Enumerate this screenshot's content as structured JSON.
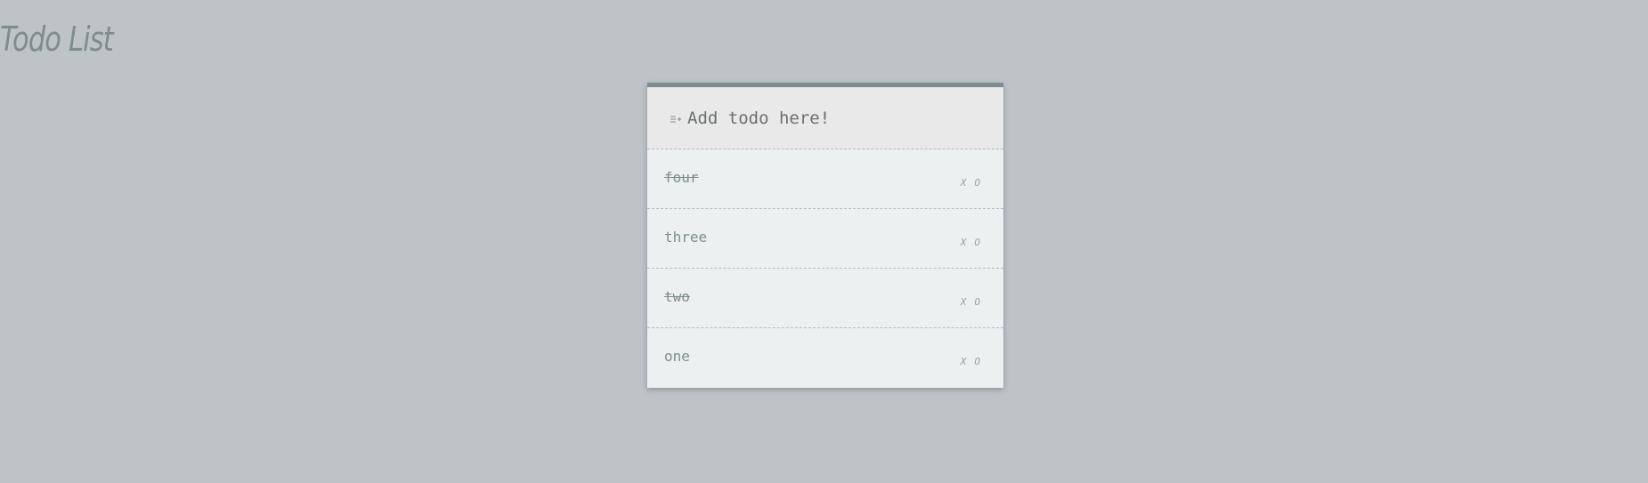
{
  "app": {
    "title": "Todo List"
  },
  "add_todo": {
    "placeholder": "Add todo here!",
    "icon": "add-list-icon"
  },
  "todos": [
    {
      "text": "four",
      "done": true,
      "delete_label": "X",
      "toggle_label": "O"
    },
    {
      "text": "three",
      "done": false,
      "delete_label": "X",
      "toggle_label": "O"
    },
    {
      "text": "two",
      "done": true,
      "delete_label": "X",
      "toggle_label": "O"
    },
    {
      "text": "one",
      "done": false,
      "delete_label": "X",
      "toggle_label": "O"
    }
  ],
  "colors": {
    "background": "#bdc3c7",
    "card": "#ecf0f1",
    "card_header": "#e9e9e9",
    "accent": "#7f8c8d"
  }
}
